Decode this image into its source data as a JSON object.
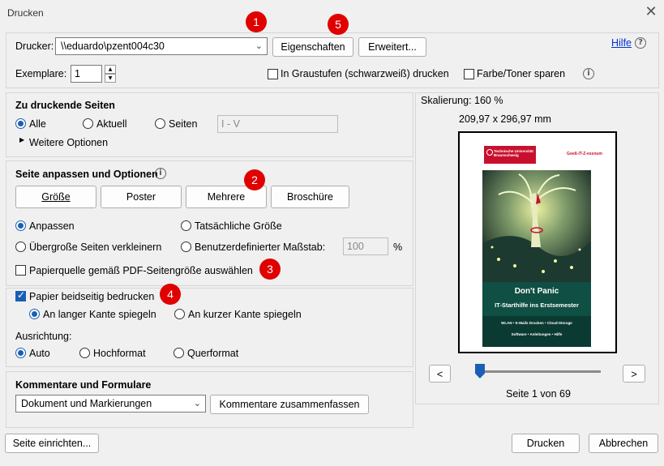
{
  "window": {
    "title": "Drucken",
    "close_glyph": "✕"
  },
  "printer": {
    "label": "Drucker:",
    "selected": "\\\\eduardo\\pzent004c30",
    "properties_button": "Eigenschaften",
    "advanced_button": "Erweitert...",
    "help_link": "Hilfe",
    "copies_label": "Exemplare:",
    "copies_value": "1",
    "grayscale_label": "In Graustufen (schwarzweiß) drucken",
    "grayscale_checked": false,
    "save_toner_label": "Farbe/Toner sparen",
    "save_toner_checked": false
  },
  "pages": {
    "header": "Zu druckende Seiten",
    "all": "Alle",
    "current": "Aktuell",
    "pages": "Seiten",
    "pages_range": "I - V",
    "more_options": "Weitere Optionen"
  },
  "fit": {
    "header": "Seite anpassen und Optionen",
    "size_button": "Größe",
    "poster_button": "Poster",
    "multiple_button": "Mehrere",
    "booklet_button": "Broschüre",
    "fit": "Anpassen",
    "actual_size": "Tatsächliche Größe",
    "shrink": "Übergroße Seiten verkleinern",
    "custom_scale": "Benutzerdefinierter Maßstab:",
    "scale_value": "100",
    "percent": "%",
    "paper_source": "Papierquelle gemäß PDF-Seitengröße auswählen"
  },
  "duplex": {
    "label": "Papier beidseitig bedrucken",
    "checked": true,
    "long_edge": "An langer Kante spiegeln",
    "short_edge": "An kurzer Kante spiegeln"
  },
  "orientation": {
    "label": "Ausrichtung:",
    "auto": "Auto",
    "portrait": "Hochformat",
    "landscape": "Querformat"
  },
  "comments": {
    "header": "Kommentare und Formulare",
    "selected": "Dokument und Markierungen",
    "summarize_button": "Kommentare zusammenfassen"
  },
  "preview": {
    "scaling": "Skalierung: 160 %",
    "dimensions": "209,97 x 296,97 mm",
    "prev_button": "<",
    "next_button": ">",
    "page_info": "Seite 1 von 69",
    "slider_fraction": 0.014,
    "poster": {
      "header_tag": "Goeß-IT-Z-essnum",
      "logo_text": "Technische Universität Braunschweig",
      "title": "Don't Panic",
      "subtitle": "IT-Starthilfe ins Erstsemester",
      "line1": "WLAN • E-Mails Drucken • Cloud-Storage",
      "line2": "Software • Anleitungen • Hilfe"
    }
  },
  "footer": {
    "page_setup_button": "Seite einrichten...",
    "print_button": "Drucken",
    "cancel_button": "Abbrechen"
  },
  "annotations": [
    "1",
    "2",
    "3",
    "4",
    "5"
  ],
  "colors": {
    "accent": "#1a5fb4",
    "badge": "#e00000",
    "link": "#0033cc"
  }
}
